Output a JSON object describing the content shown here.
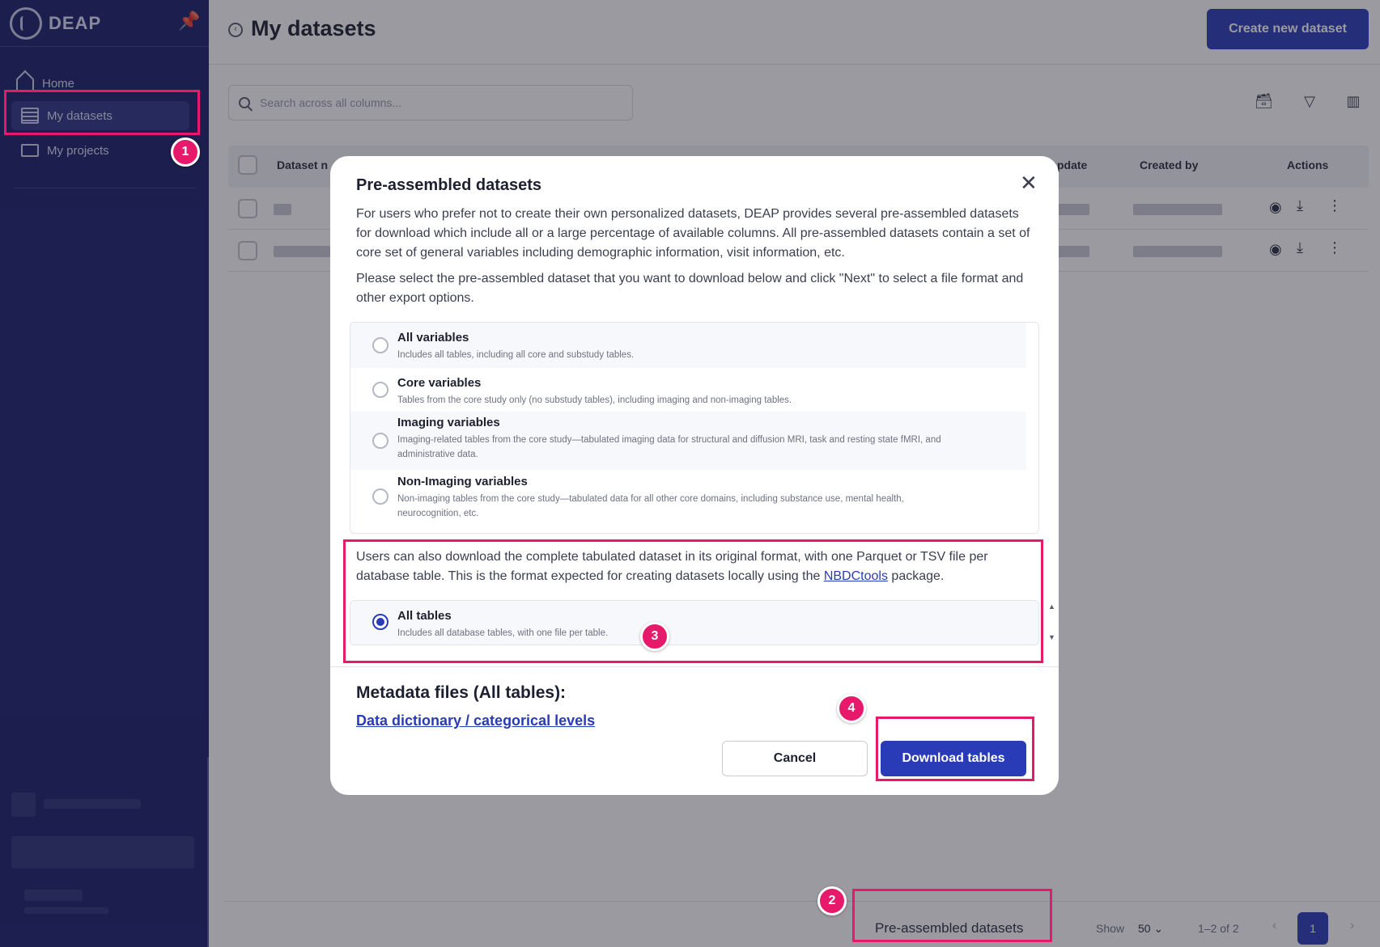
{
  "app": {
    "logo_text": "DEAP"
  },
  "sidebar": {
    "items": [
      {
        "label": "Home",
        "icon": "home-icon"
      },
      {
        "label": "My datasets",
        "icon": "list-icon"
      },
      {
        "label": "My projects",
        "icon": "folder-icon"
      }
    ]
  },
  "header": {
    "title": "My datasets",
    "create_button": "Create new dataset"
  },
  "search": {
    "placeholder": "Search across all columns..."
  },
  "table": {
    "columns": [
      "Dataset n",
      "pdate",
      "Created by",
      "Actions"
    ]
  },
  "footer": {
    "pre_assembled_link": "Pre-assembled datasets",
    "show_label": "Show",
    "page_size": "50",
    "range": "1–2 of 2",
    "current_page": "1"
  },
  "modal": {
    "title": "Pre-assembled datasets",
    "intro": "For users who prefer not to create their own personalized datasets, DEAP provides several pre-assembled datasets for download which include all or a large percentage of available columns. All pre-assembled datasets contain a set of core set of general variables including demographic information, visit information, etc.",
    "instruction": "Please select the pre-assembled dataset that you want to download below and click \"Next\" to select a file format and other export options.",
    "options": [
      {
        "name": "All variables",
        "desc": "Includes all tables, including all core and substudy tables.",
        "selected": false
      },
      {
        "name": "Core variables",
        "desc": "Tables from the core study only (no substudy tables), including imaging and non-imaging tables.",
        "selected": false
      },
      {
        "name": "Imaging variables",
        "desc": "Imaging-related tables from the core study—tabulated imaging data for structural and diffusion MRI, task and resting state fMRI, and administrative data.",
        "selected": false
      },
      {
        "name": "Non-Imaging variables",
        "desc": "Non-imaging tables from the core study—tabulated data for all other core domains, including substance use, mental health, neurocognition, etc.",
        "selected": false
      }
    ],
    "tabulated_text_1": "Users can also download the complete tabulated dataset in its original format, with one Parquet or TSV file per database table. This is the format expected for creating datasets locally using the",
    "tabulated_link": "NBDCtools",
    "tabulated_text_2": "package.",
    "all_tables": {
      "name": "All tables",
      "desc": "Includes all database tables, with one file per table.",
      "selected": true
    },
    "metadata_title": "Metadata files (All tables):",
    "metadata_link": "Data dictionary / categorical levels",
    "cancel": "Cancel",
    "download": "Download tables"
  },
  "annotations": [
    "1",
    "2",
    "3",
    "4"
  ],
  "colors": {
    "sidebar": "#1b1f6b",
    "primary": "#2a3bb8",
    "highlight": "#e6196b"
  }
}
